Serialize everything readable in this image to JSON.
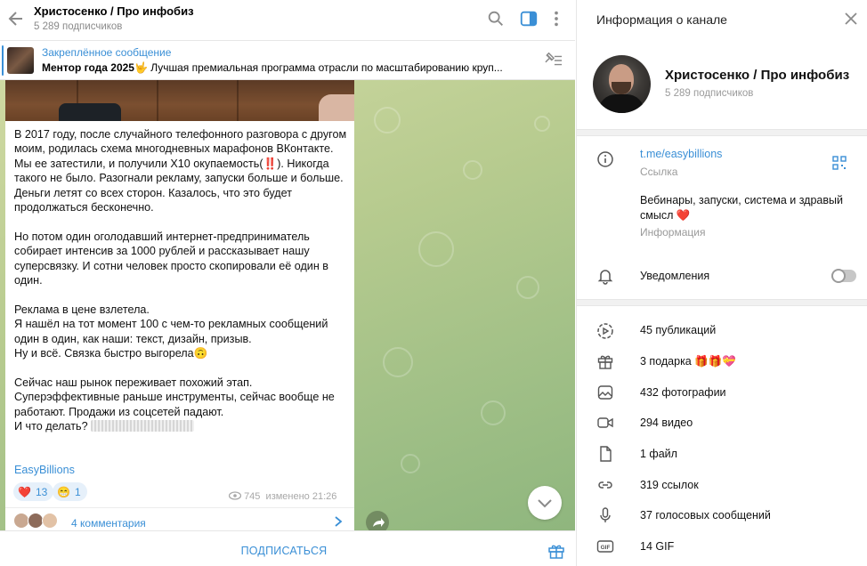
{
  "chat": {
    "title": "Христосенко / Про инфобиз",
    "subscribers": "5 289 подписчиков",
    "pinned": {
      "label": "Закреплённое сообщение",
      "bold": "Ментор года 2025🤟",
      "text": " Лучшая премиальная программа отрасли по масштабированию круп..."
    },
    "message": {
      "p1_a": "В 2017 году, после случайного телефонного разговора с другом моим, родилась схема многодневных марафонов ВКонтакте. Мы ее затестили, и получили Х10 окупаемость(",
      "p1_emoji": "‼️",
      "p1_b": "). Никогда такого не было. Разогнали рекламу, запуски больше и больше. Деньги летят со всех сторон. Казалось, что это будет продолжаться бесконечно.",
      "p2": "Но потом один оголодавший интернет-предприниматель собирает интенсив за 1000 рублей и рассказывает нашу суперсвязку. И сотни человек просто скопировали её один в один.",
      "p3": "Реклама в цене взлетела.\nЯ нашёл на тот момент 100 с чем-то рекламных сообщений один в один, как наши: текст, дизайн, призыв.\nНу и всё. Связка быстро выгорела🙃",
      "p4": "Сейчас наш рынок переживает похожий этап.\nСуперэффективные раньше инструменты, сейчас вообще не работают. Продажи из соцсетей падают.\nИ что делать?",
      "signature": "EasyBillions",
      "reactions": [
        {
          "emoji": "❤️",
          "count": "13"
        },
        {
          "emoji": "😁",
          "count": "1"
        }
      ],
      "views": "745",
      "edited": "изменено 21:26",
      "comments": "4 комментария"
    },
    "subscribe_label": "ПОДПИСАТЬСЯ"
  },
  "info": {
    "title": "Информация о канале",
    "name": "Христосенко / Про инфобиз",
    "subscribers": "5 289 подписчиков",
    "link": "t.me/easybillions",
    "link_label": "Ссылка",
    "about": "Вебинары, запуски, система и здравый смысл ❤️",
    "about_label": "Информация",
    "notifications": "Уведомления",
    "notifications_on": false,
    "stats": [
      {
        "icon": "publications-icon",
        "label": "45 публикаций"
      },
      {
        "icon": "gift-icon",
        "label": "3 подарка 🎁🎁💝"
      },
      {
        "icon": "photo-icon",
        "label": "432 фотографии"
      },
      {
        "icon": "video-icon",
        "label": "294 видео"
      },
      {
        "icon": "file-icon",
        "label": "1 файл"
      },
      {
        "icon": "link-icon",
        "label": "319 ссылок"
      },
      {
        "icon": "microphone-icon",
        "label": "37 голосовых сообщений"
      },
      {
        "icon": "gif-icon",
        "label": "14 GIF"
      }
    ]
  },
  "colors": {
    "accent": "#3a8fd6",
    "muted": "#9a9a9a",
    "wallpaper": "#b7cb8f"
  }
}
